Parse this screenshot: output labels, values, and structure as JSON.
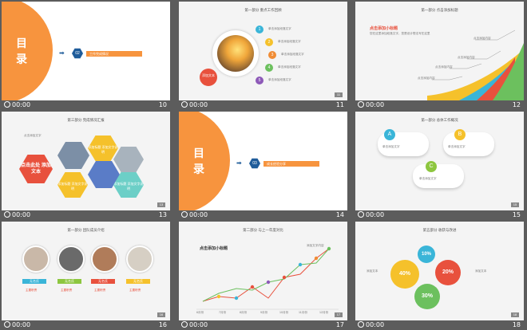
{
  "thumbs": [
    {
      "time": "00:00",
      "num": "10",
      "big": "目",
      "big2": "录",
      "badge": "02",
      "bar": "工作完成情况"
    },
    {
      "time": "00:00",
      "num": "11",
      "title": "第一部分 重点工作回顾",
      "center": "添加文本",
      "items": [
        "单击添加段落文字",
        "单击添加段落文字",
        "单击添加段落文字",
        "单击添加段落文字",
        "单击添加段落文字"
      ],
      "circles": [
        "1",
        "2",
        "3",
        "4",
        "5"
      ],
      "pg": "11"
    },
    {
      "time": "00:00",
      "num": "12",
      "title": "第一部分 点击添加标题",
      "heading": "点击添加小标题",
      "body": "您在这里添加段落文字，您是设计想法写在这里",
      "labels": [
        "点击添加内容",
        "点击添加内容",
        "点击添加内容",
        "点击添加内容"
      ],
      "pg": "12"
    },
    {
      "time": "00:00",
      "num": "13",
      "title": "第三部分 完成情况汇报",
      "sub": "点击添加文字",
      "hex_red": "点击此处 添加文本",
      "hex_labels": [
        "添加标题 添加文字说明",
        "添加标题 添加文字说明",
        "添加标题 添加文字说明"
      ],
      "pg": "13"
    },
    {
      "time": "00:00",
      "num": "14",
      "big": "目",
      "big2": "录",
      "badge": "03",
      "bar": "成长经验分享"
    },
    {
      "time": "00:00",
      "num": "15",
      "title": "第一部分 总体工作概况",
      "letters": [
        "A",
        "B",
        "C"
      ],
      "text": "单击添加文字",
      "pg": "15"
    },
    {
      "time": "00:00",
      "num": "16",
      "title": "第一部分 团队成员介绍",
      "names": [
        "无名氏",
        "无名氏",
        "无名氏",
        "无名氏"
      ],
      "role": "主要职责",
      "pg": "16"
    },
    {
      "time": "00:00",
      "num": "17",
      "title": "第二部分 与上一年度对比",
      "heading": "点击添加小标题",
      "months": [
        "6月份",
        "7月份",
        "8月份",
        "9月份",
        "10月份",
        "11月份",
        "12月份"
      ],
      "pt": "添加文字内容",
      "pg": "17"
    },
    {
      "time": "00:00",
      "num": "18",
      "title": "第五部分 收获与改进",
      "v1": "40%",
      "v2": "10%",
      "v3": "20%",
      "v4": "30%",
      "add": "添加文本",
      "pg": "18"
    }
  ]
}
